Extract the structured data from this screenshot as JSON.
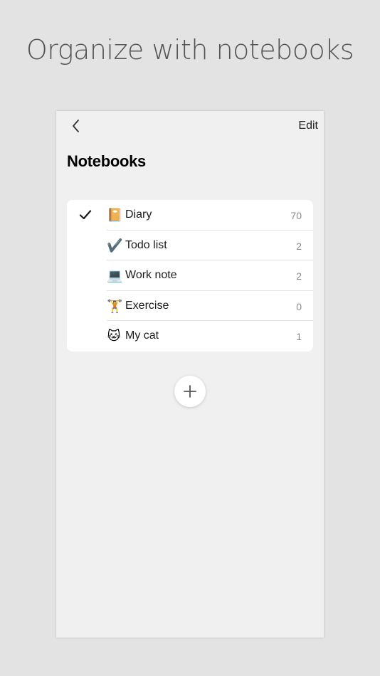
{
  "headline": "Organize with notebooks",
  "nav": {
    "back_icon": "chevron-left-icon",
    "edit_label": "Edit"
  },
  "title": "Notebooks",
  "notebooks": [
    {
      "emoji": "📔",
      "icon": "notebook-icon",
      "name": "Diary",
      "count": "70",
      "selected": true
    },
    {
      "emoji": "✔️",
      "icon": "checkmark-icon",
      "name": "Todo list",
      "count": "2",
      "selected": false
    },
    {
      "emoji": "💻",
      "icon": "laptop-icon",
      "name": "Work note",
      "count": "2",
      "selected": false
    },
    {
      "emoji": "🏋️",
      "icon": "weightlifter-icon",
      "name": "Exercise",
      "count": "0",
      "selected": false
    },
    {
      "emoji": "🐱",
      "icon": "cat-icon",
      "name": "My cat",
      "count": "1",
      "selected": false
    }
  ],
  "add_button": {
    "icon": "plus-icon"
  },
  "colors": {
    "background": "#e3e3e3",
    "screen": "#f0f0f0",
    "card": "#ffffff",
    "text": "#1a1a1a",
    "count": "#8a8a8a"
  }
}
